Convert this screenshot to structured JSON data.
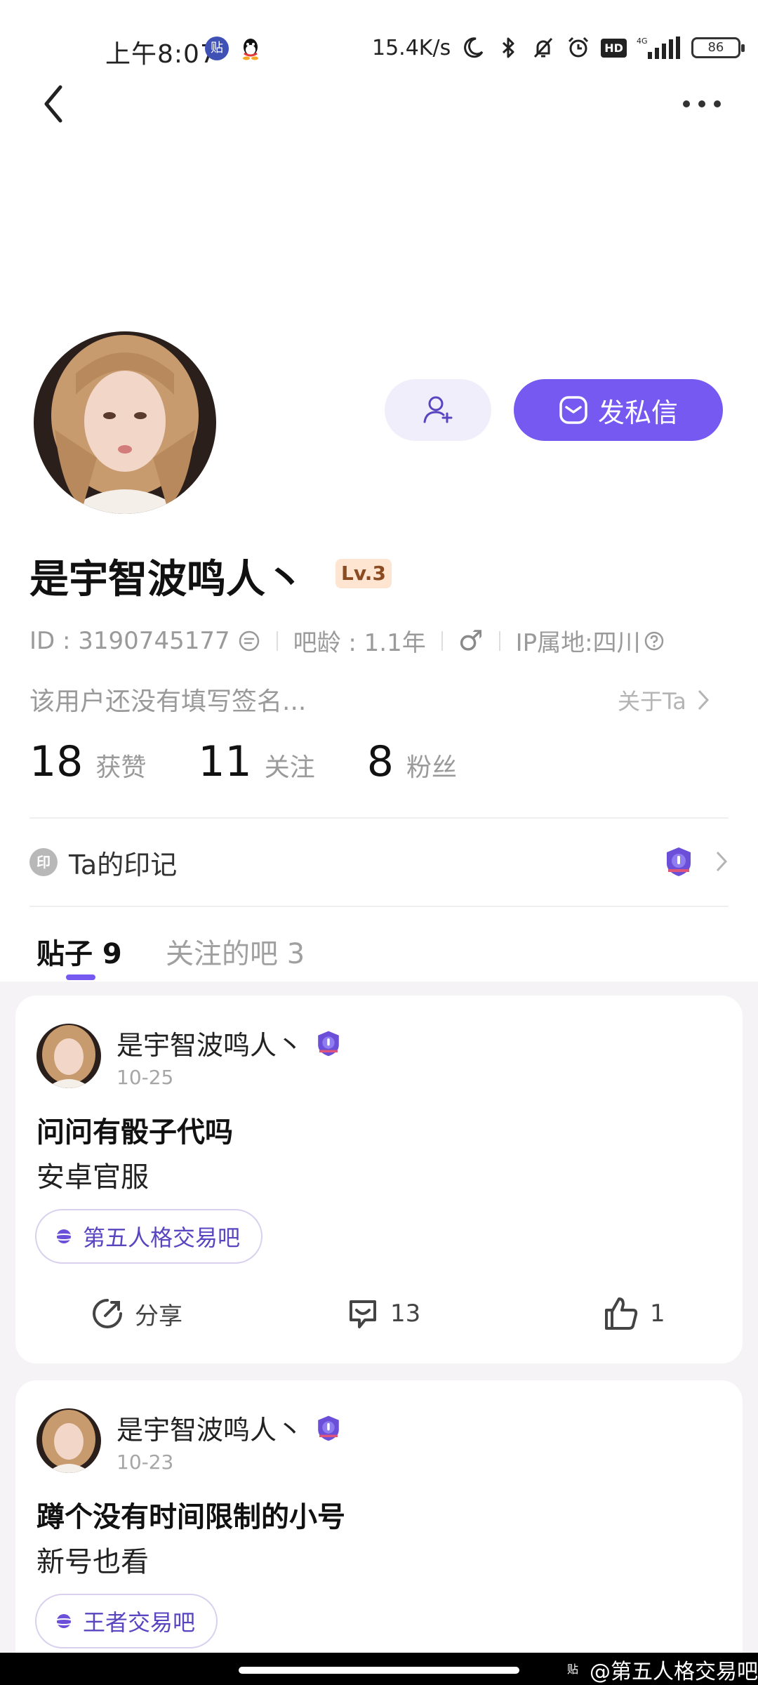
{
  "status_bar": {
    "time": "上午8:07",
    "app_badge": "贴",
    "net_speed": "15.4K/s",
    "signal_label": "4G",
    "battery": "86"
  },
  "profile": {
    "name": "是宇智波鸣人丶",
    "level": "Lv.3",
    "id_text": "ID : 3190745177",
    "bar_age": "吧龄 : 1.1年",
    "gender_symbol": "♂",
    "ip_location": "IP属地:四川",
    "bio": "该用户还没有填写签名...",
    "about_label": "关于Ta",
    "message_button": "发私信"
  },
  "stats": [
    {
      "value": "18",
      "label": "获赞"
    },
    {
      "value": "11",
      "label": "关注"
    },
    {
      "value": "8",
      "label": "粉丝"
    }
  ],
  "mark": {
    "icon_text": "印",
    "label": "Ta的印记"
  },
  "tabs": [
    {
      "label": "贴子 9",
      "active": true
    },
    {
      "label": "关注的吧 3",
      "active": false
    }
  ],
  "posts": [
    {
      "author": "是宇智波鸣人丶",
      "date": "10-25",
      "title": "问问有骰子代吗",
      "body": "安卓官服",
      "forum": "第五人格交易吧",
      "share_label": "分享",
      "comments": "13",
      "likes": "1"
    },
    {
      "author": "是宇智波鸣人丶",
      "date": "10-23",
      "title": "蹲个没有时间限制的小号",
      "body": "新号也看",
      "forum": "王者交易吧"
    }
  ],
  "watermark": {
    "badge": "贴",
    "text": "@第五人格交易吧"
  },
  "colors": {
    "accent": "#7559f0",
    "accent_light": "#f1eefb",
    "feed_background": "#f5f3f6",
    "level_badge": "#fde5d1"
  }
}
